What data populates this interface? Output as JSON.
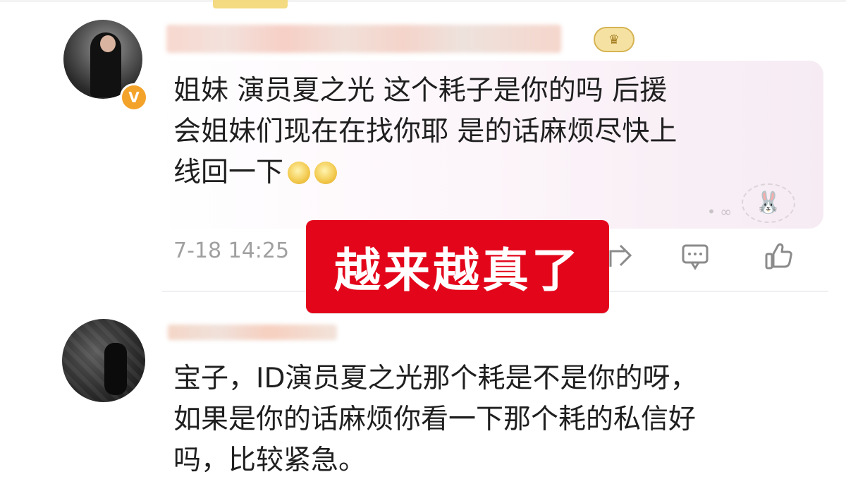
{
  "overlay": {
    "label": "越来越真了"
  },
  "comments": [
    {
      "username_visible_fragment": "ㄲㄴ",
      "rank_badge": "♛",
      "verified_badge": "V",
      "text_lines": [
        "姐妹 演员夏之光 这个耗子是你的吗 后援",
        "会姐妹们现在在找你耶 是的话麻烦尽快上",
        "线回一下"
      ],
      "timestamp": "7-18 14:25",
      "deco_suffix": "• ∞"
    },
    {
      "text_lines": [
        "宝子，ID演员夏之光那个耗是不是你的呀，",
        "如果是你的话麻烦你看一下那个耗的私信好",
        "吗，比较紧急。"
      ]
    }
  ],
  "icons": {
    "share": "share-icon",
    "comment": "comment-icon",
    "like": "like-icon",
    "emoji": "emoji-icon"
  },
  "colors": {
    "overlay": "#e3061b",
    "verified": "#f3a22a",
    "text": "#1f1f1f",
    "meta": "#a0a0a0"
  }
}
